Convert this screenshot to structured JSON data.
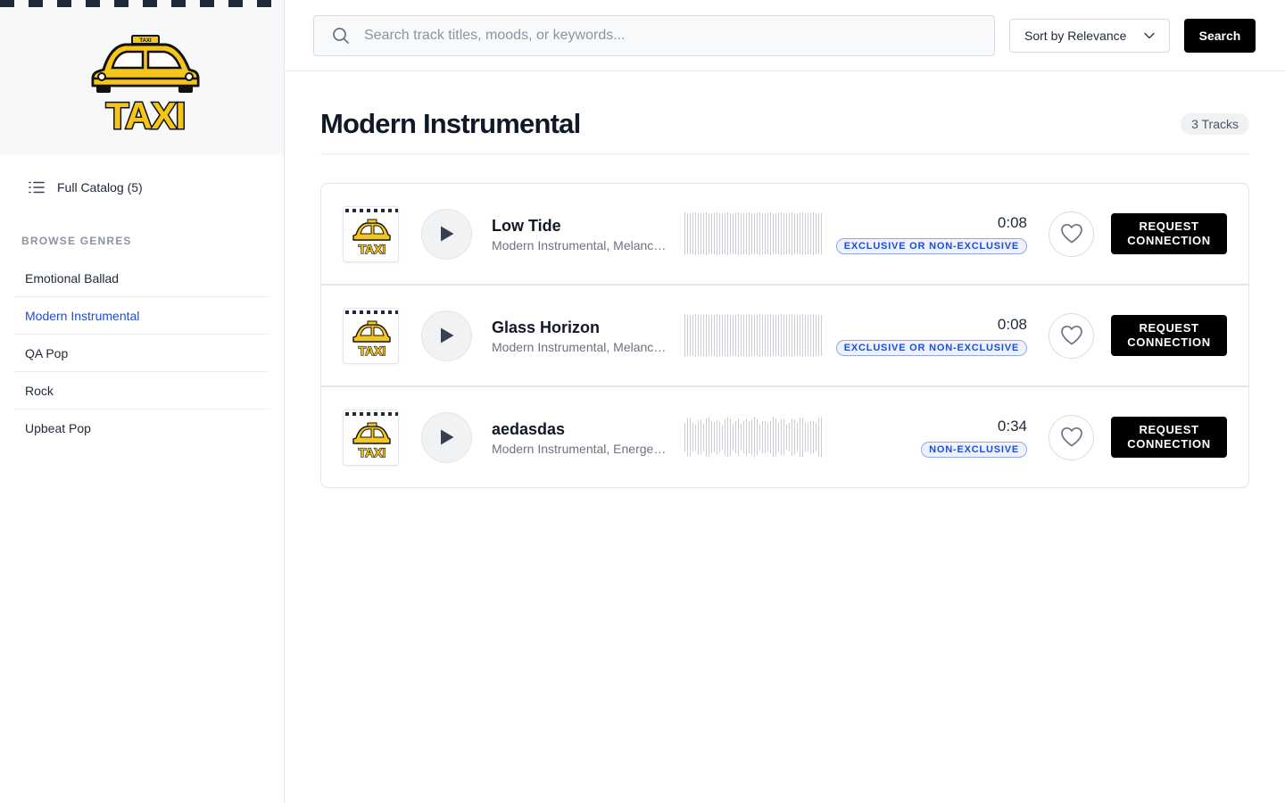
{
  "brand": {
    "logo_text": "TAXI",
    "roof_sign": "TAXI"
  },
  "sidebar": {
    "catalog_label": "Full Catalog (5)",
    "section_label": "BROWSE GENRES",
    "genres": [
      {
        "label": "Emotional Ballad",
        "active": false
      },
      {
        "label": "Modern Instrumental",
        "active": true
      },
      {
        "label": "QA Pop",
        "active": false
      },
      {
        "label": "Rock",
        "active": false
      },
      {
        "label": "Upbeat Pop",
        "active": false
      }
    ]
  },
  "topbar": {
    "search_placeholder": "Search track titles, moods, or keywords...",
    "search_value": "",
    "sort_label": "Sort by Relevance",
    "search_button": "Search"
  },
  "main": {
    "title": "Modern Instrumental",
    "count": "3 Tracks",
    "tracks": [
      {
        "thumb_text": "TAXI",
        "title": "Low Tide",
        "genres": "Modern Instrumental, Melancholic, Cinematic",
        "duration": "0:08",
        "license": "EXCLUSIVE OR NON-EXCLUSIVE",
        "waveform": "flat",
        "action": "REQUEST CONNECTION"
      },
      {
        "thumb_text": "TAXI",
        "title": "Glass Horizon",
        "genres": "Modern Instrumental, Melancholic, Cinematic",
        "duration": "0:08",
        "license": "EXCLUSIVE OR NON-EXCLUSIVE",
        "waveform": "flat",
        "action": "REQUEST CONNECTION"
      },
      {
        "thumb_text": "TAXI",
        "title": "aedasdas",
        "genres": "Modern Instrumental, Energetic, Uplifting",
        "duration": "0:34",
        "license": "NON-EXCLUSIVE",
        "waveform": "varied",
        "action": "REQUEST CONNECTION"
      }
    ]
  },
  "colors": {
    "accent": "#1d4ed8",
    "taxi_yellow": "#f5c518",
    "ink": "#111827"
  },
  "icons": [
    "list-icon",
    "search-icon",
    "chevron-down-icon",
    "play-icon",
    "heart-icon"
  ]
}
